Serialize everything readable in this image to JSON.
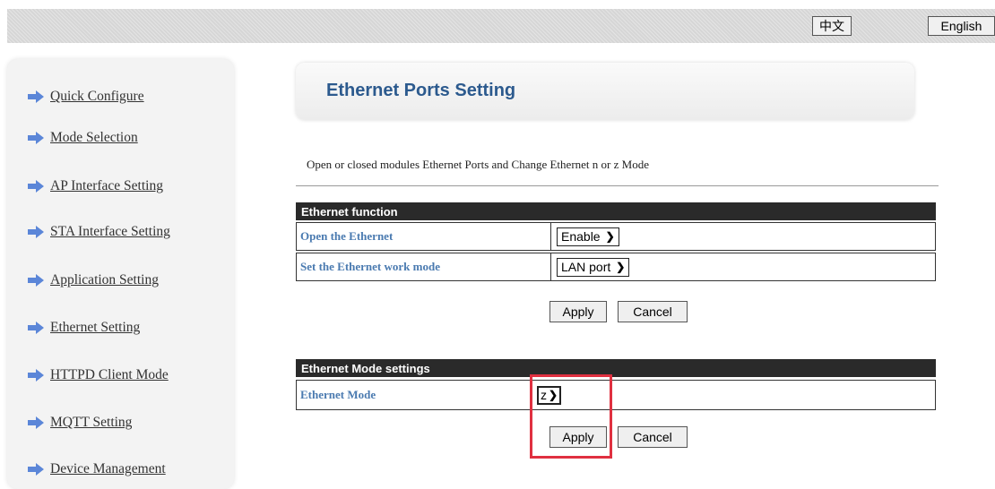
{
  "topbar": {
    "lang_zh": "中文",
    "lang_en": "English"
  },
  "sidebar": {
    "items": [
      {
        "label": "Quick Configure",
        "icon": "arrow-right-icon"
      },
      {
        "label": "Mode Selection",
        "icon": "arrow-right-icon"
      },
      {
        "label": "AP Interface Setting",
        "icon": "arrow-right-icon"
      },
      {
        "label": "STA Interface Setting",
        "icon": "arrow-right-icon"
      },
      {
        "label": "Application Setting",
        "icon": "arrow-right-icon"
      },
      {
        "label": "Ethernet Setting",
        "icon": "arrow-right-icon"
      },
      {
        "label": "HTTPD Client Mode",
        "icon": "arrow-right-icon"
      },
      {
        "label": "MQTT Setting",
        "icon": "arrow-right-icon"
      },
      {
        "label": "Device Management",
        "icon": "arrow-right-icon"
      }
    ]
  },
  "main": {
    "title": "Ethernet Ports Setting",
    "description": "Open or closed modules Ethernet Ports and Change Ethernet n or z Mode",
    "ethernet_function": {
      "header": "Ethernet function",
      "rows": [
        {
          "label": "Open the Ethernet",
          "value": "Enable"
        },
        {
          "label": "Set the Ethernet work mode",
          "value": "LAN port"
        }
      ],
      "apply_label": "Apply",
      "cancel_label": "Cancel"
    },
    "ethernet_mode": {
      "header": "Ethernet Mode settings",
      "rows": [
        {
          "label": "Ethernet Mode",
          "value": "z"
        }
      ],
      "apply_label": "Apply",
      "cancel_label": "Cancel"
    }
  },
  "colors": {
    "title_blue": "#2c5a8e",
    "label_blue": "#4a7ab0",
    "header_dark": "#2a2a2a",
    "highlight_red": "#e03040",
    "arrow_blue": "#5b86d8"
  }
}
